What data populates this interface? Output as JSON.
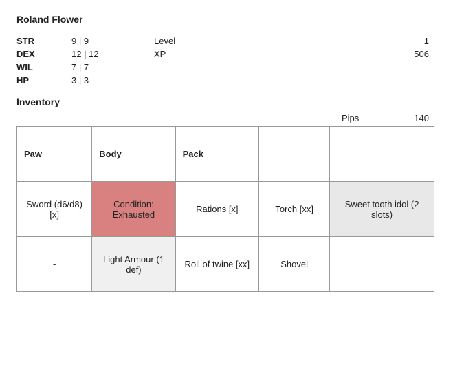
{
  "character": {
    "name": "Roland Flower",
    "stats": {
      "str_label": "STR",
      "str_value": "9 | 9",
      "dex_label": "DEX",
      "dex_value": "12 | 12",
      "wil_label": "WIL",
      "wil_value": "7 | 7",
      "hp_label": "HP",
      "hp_value": "3 | 3",
      "level_label": "Level",
      "level_value": "1",
      "xp_label": "XP",
      "xp_value": "506"
    },
    "inventory": {
      "section_title": "Inventory",
      "pips_label": "Pips",
      "pips_value": "140",
      "columns": {
        "paw": "Paw",
        "body": "Body",
        "pack": "Pack"
      },
      "rows": [
        {
          "paw": "Sword (d6/d8) [x]",
          "body": "Condition: Exhausted",
          "pack": "Rations [x]",
          "torch": "Torch [xx]",
          "extra": "Sweet tooth idol (2 slots)"
        },
        {
          "paw": "-",
          "body": "Light Armour (1 def)",
          "pack": "Roll of twine [xx]",
          "torch": "Shovel",
          "extra": ""
        }
      ]
    }
  }
}
